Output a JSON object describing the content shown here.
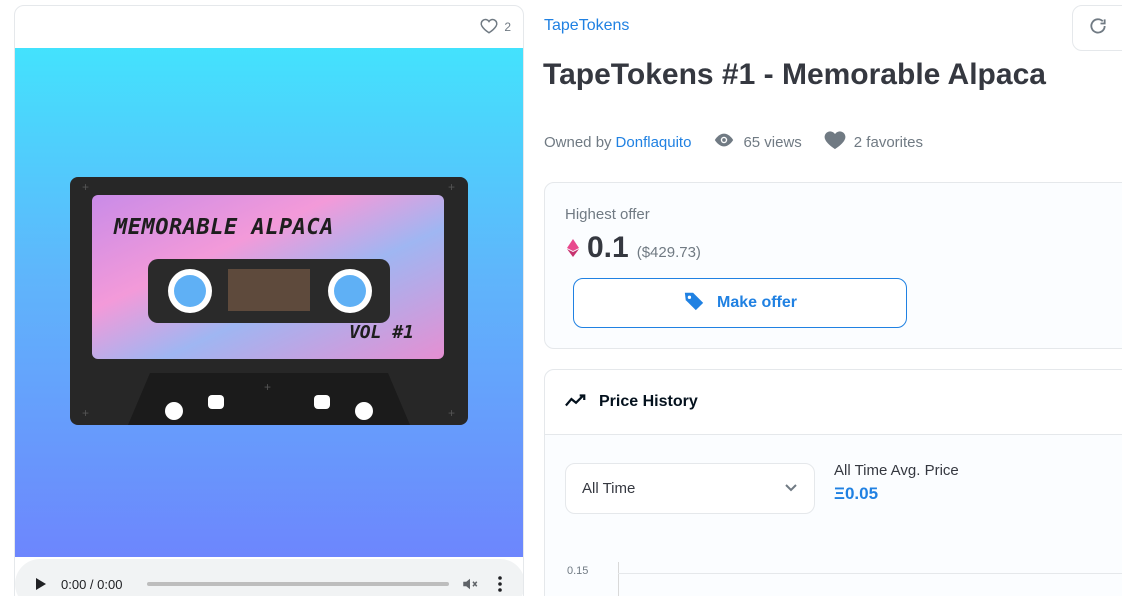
{
  "favorites_count_small": "2",
  "artwork": {
    "cassette_title": "MEMORABLE ALPACA",
    "cassette_volume": "VOL #1",
    "bg_top": "#43e2fd",
    "bg_bottom": "#6d86fd"
  },
  "audio": {
    "time": "0:00 / 0:00"
  },
  "collection": {
    "name": "TapeTokens"
  },
  "item": {
    "title": "TapeTokens #1 - Memorable Alpaca"
  },
  "meta": {
    "owned_by": "Owned by",
    "owner": "Donflaquito",
    "views": "65 views",
    "favorites": "2 favorites"
  },
  "offer": {
    "label": "Highest offer",
    "price": "0.1",
    "usd": "($429.73)",
    "button": "Make offer"
  },
  "price_history": {
    "title": "Price History",
    "range_selected": "All Time",
    "avg_label": "All Time Avg. Price",
    "avg_value": "Ξ0.05",
    "y_tick": "0.15"
  },
  "colors": {
    "accent": "#2081e2",
    "text": "#353840",
    "muted": "#707a83"
  }
}
